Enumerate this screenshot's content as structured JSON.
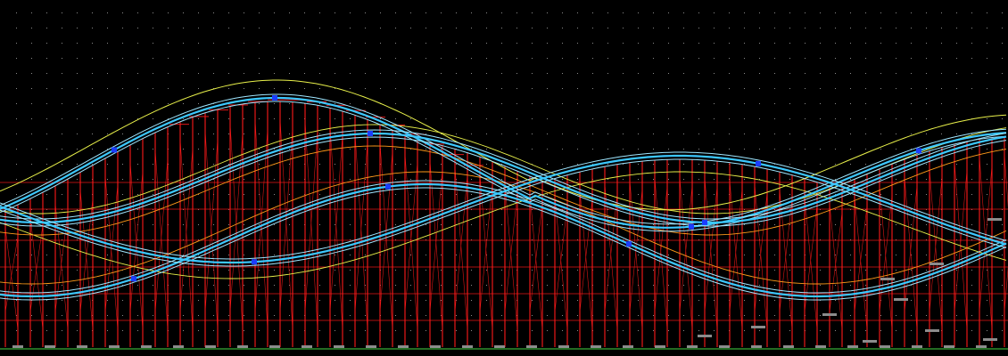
{
  "canvas": {
    "background_color": "#000000",
    "grid_dot_color": "#8a8a8a"
  },
  "colors": {
    "support_structure": "#ff1a1a",
    "track_centerline": "#3cc8ff",
    "track_rails": "#9fe6ff",
    "track_guide_a": "#e8f04a",
    "track_guide_b": "#ff9a1a",
    "node_marker": "#1b3dff",
    "footing": "#8c8c8c",
    "ground_line": "#2f8f2f"
  },
  "layers": {
    "supports": "support-structure",
    "track": "coaster-track",
    "guides": "guide-curves",
    "markers": "node-markers",
    "footings": "footing-pads"
  }
}
